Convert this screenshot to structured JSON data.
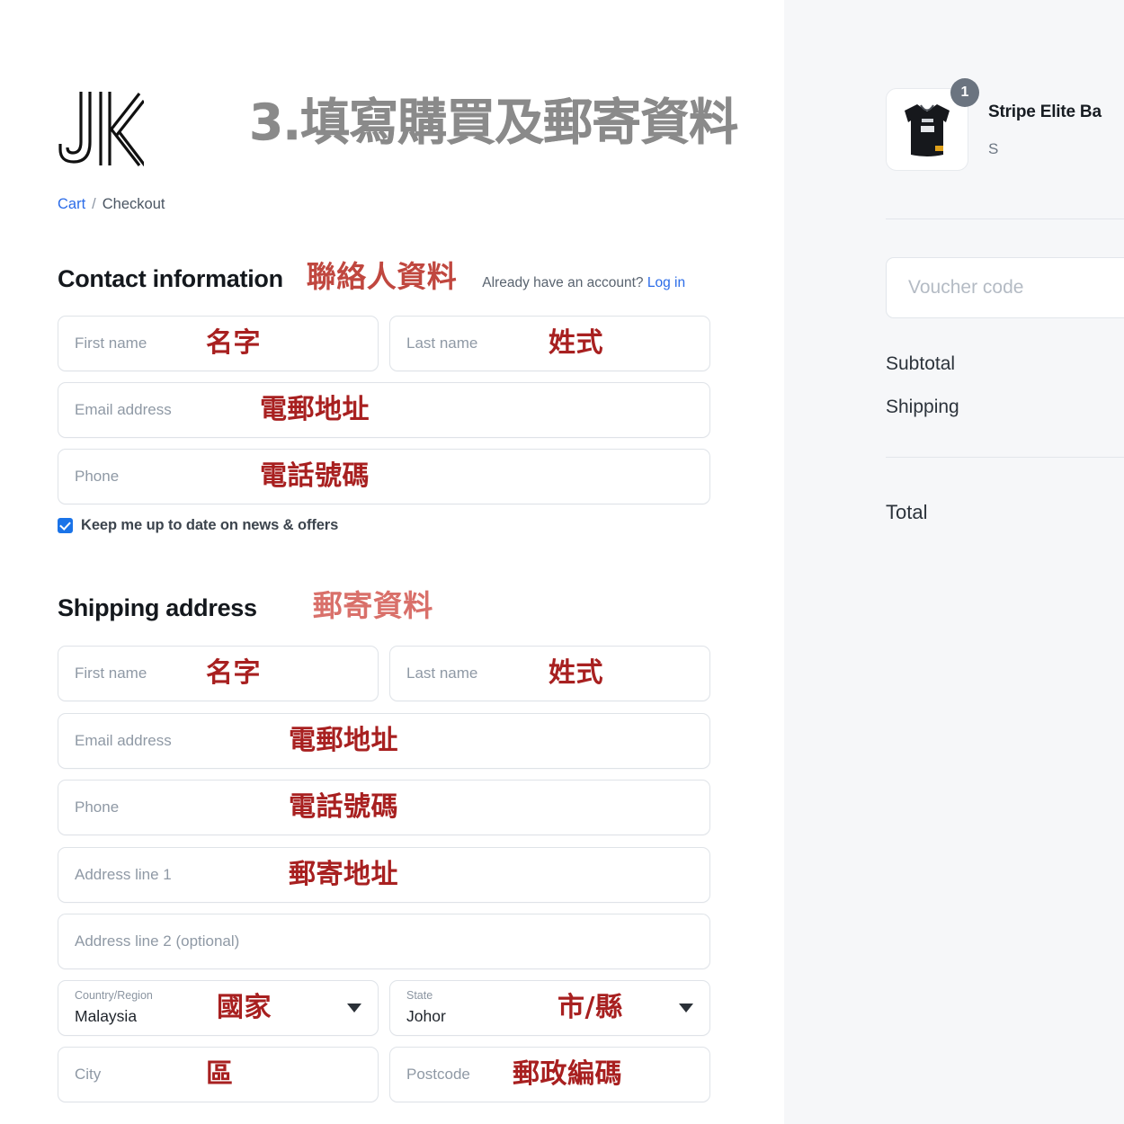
{
  "brand": {
    "logo_name": "jk-monogram"
  },
  "header": {
    "step_title": "3.填寫購買及郵寄資料"
  },
  "breadcrumb": {
    "cart": "Cart",
    "separator": "/",
    "current": "Checkout"
  },
  "contact": {
    "heading": "Contact information",
    "heading_note": "聯絡人資料",
    "account_prompt": "Already have an account?",
    "login_link": "Log in",
    "fields": {
      "first_name": {
        "placeholder": "First name",
        "note": "名字"
      },
      "last_name": {
        "placeholder": "Last name",
        "note": "姓式"
      },
      "email": {
        "placeholder": "Email address",
        "note": "電郵地址"
      },
      "phone": {
        "placeholder": "Phone",
        "note": "電話號碼"
      }
    },
    "newsletter_label": "Keep me up to date on news & offers",
    "newsletter_checked": true
  },
  "shipping": {
    "heading": "Shipping address",
    "heading_note": "郵寄資料",
    "fields": {
      "first_name": {
        "placeholder": "First name",
        "note": "名字"
      },
      "last_name": {
        "placeholder": "Last name",
        "note": "姓式"
      },
      "email": {
        "placeholder": "Email address",
        "note": "電郵地址"
      },
      "phone": {
        "placeholder": "Phone",
        "note": "電話號碼"
      },
      "address1": {
        "placeholder": "Address line 1",
        "note": "郵寄地址"
      },
      "address2": {
        "placeholder": "Address line 2 (optional)",
        "note": ""
      },
      "country": {
        "label": "Country/Region",
        "value": "Malaysia",
        "note": "國家"
      },
      "state": {
        "label": "State",
        "value": "Johor",
        "note": "市/縣"
      },
      "city": {
        "placeholder": "City",
        "note": "區"
      },
      "postcode": {
        "placeholder": "Postcode",
        "note": "郵政編碼"
      }
    }
  },
  "summary": {
    "item": {
      "name": "Stripe Elite Ba",
      "variant": "S",
      "quantity": "1",
      "thumb_name": "basketball-jersey-thumbnail"
    },
    "voucher_placeholder": "Voucher code",
    "subtotal_label": "Subtotal",
    "shipping_label": "Shipping",
    "total_label": "Total"
  },
  "colors": {
    "accent_blue": "#2b6ce8",
    "note_deep_red": "#a82020",
    "note_light_red": "#d9706a",
    "title_gray": "#8a8a8a",
    "panel_bg": "#f6f7f9"
  }
}
